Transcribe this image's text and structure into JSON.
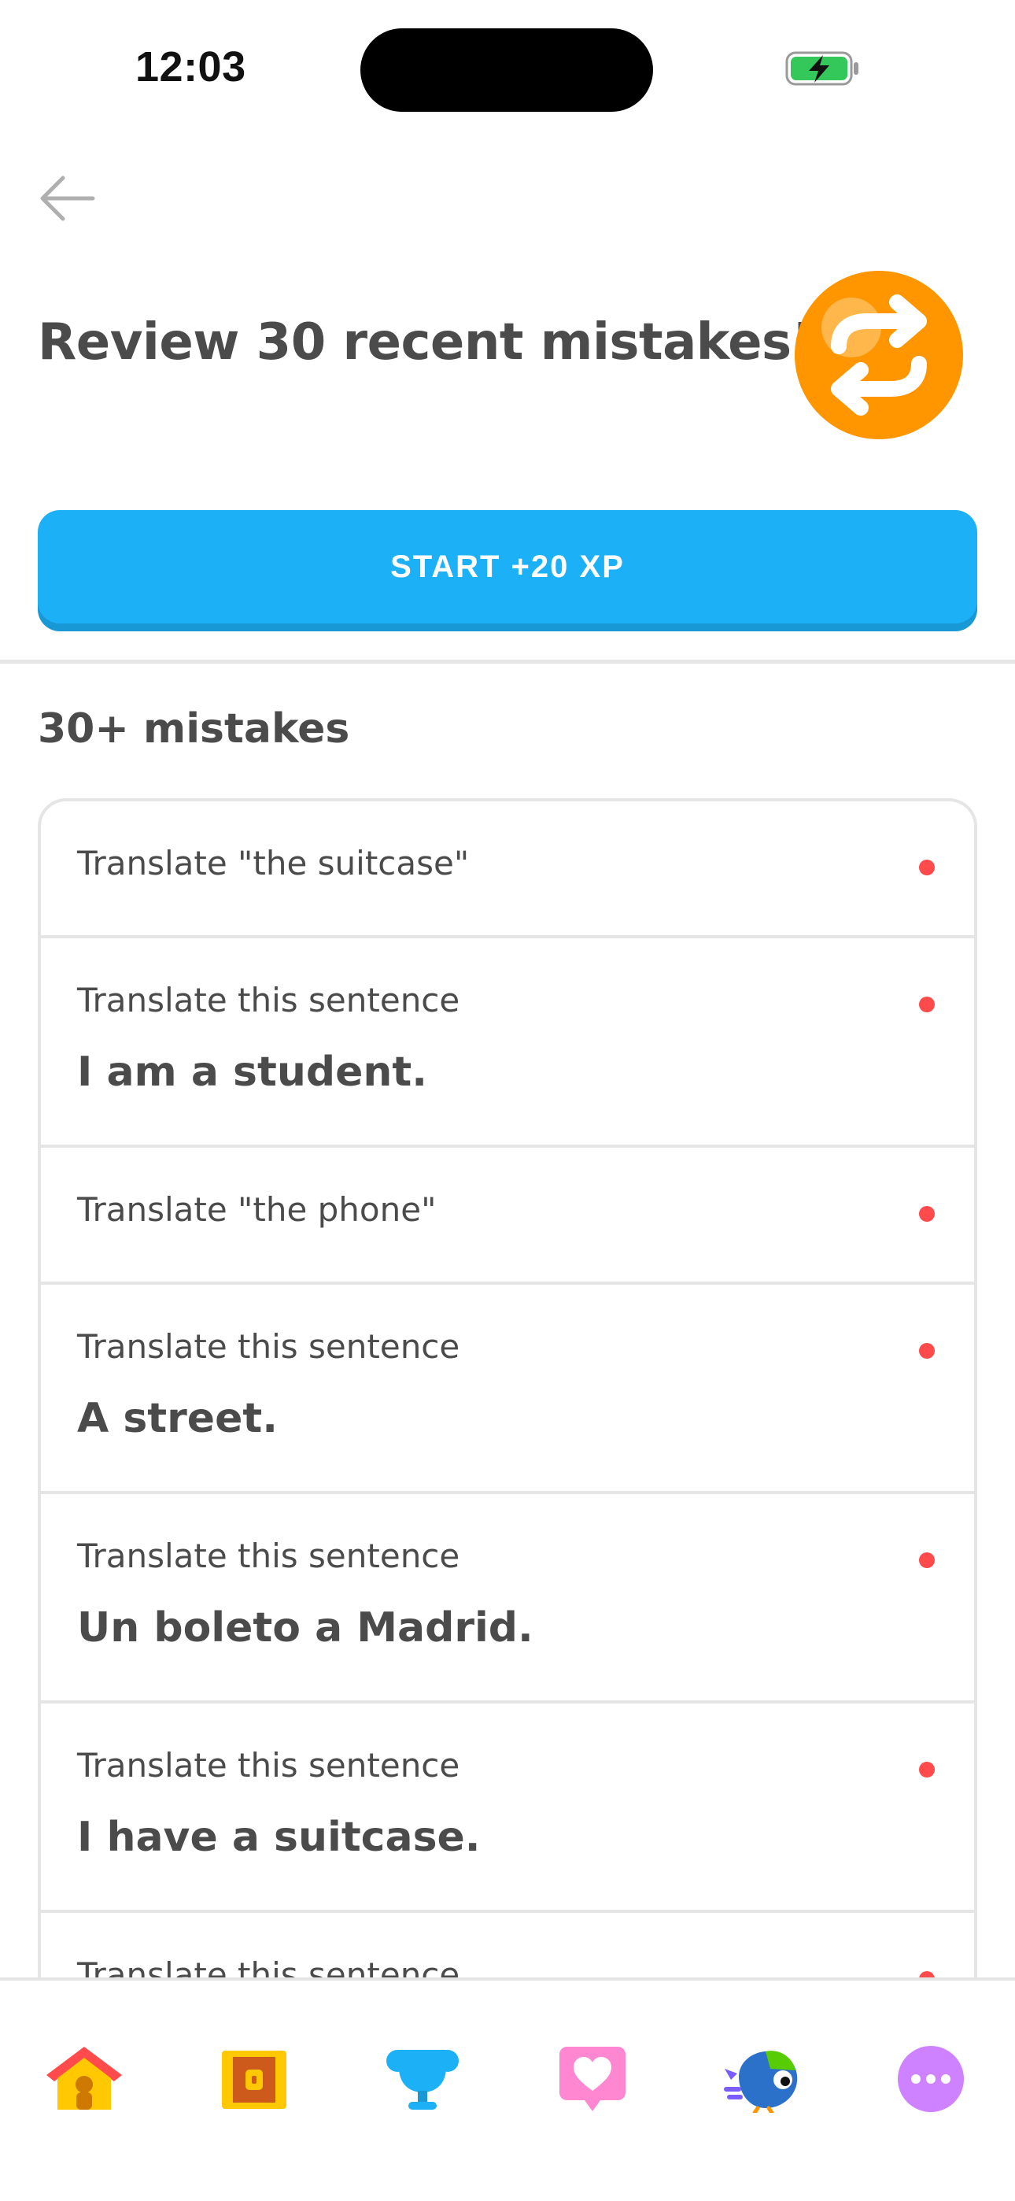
{
  "status_bar": {
    "time": "12:03",
    "battery_icon": "battery-charging-icon"
  },
  "header": {
    "back_icon": "arrow-left-icon",
    "title": "Review 30 recent mistakes!",
    "badge_icon": "refresh-arrows-icon"
  },
  "start_button": {
    "label": "START +20 XP"
  },
  "section": {
    "title": "30+ mistakes"
  },
  "mistakes": [
    {
      "prompt": "Translate \"the suitcase\"",
      "sentence": ""
    },
    {
      "prompt": "Translate this sentence",
      "sentence": "I am a student."
    },
    {
      "prompt": "Translate \"the phone\"",
      "sentence": ""
    },
    {
      "prompt": "Translate this sentence",
      "sentence": "A street."
    },
    {
      "prompt": "Translate this sentence",
      "sentence": "Un boleto a Madrid."
    },
    {
      "prompt": "Translate this sentence",
      "sentence": "I have a suitcase."
    },
    {
      "prompt": "Translate this sentence",
      "sentence": ""
    }
  ],
  "nav": [
    {
      "name": "home-icon"
    },
    {
      "name": "treasure-chest-icon"
    },
    {
      "name": "trophy-icon"
    },
    {
      "name": "heart-icon"
    },
    {
      "name": "duo-bird-icon"
    },
    {
      "name": "more-icon"
    }
  ],
  "colors": {
    "accent_blue": "#1cb0f6",
    "badge_orange": "#ff9600",
    "error_red": "#ff4b4b",
    "text": "#4b4b4b",
    "border": "#e5e5e5"
  }
}
